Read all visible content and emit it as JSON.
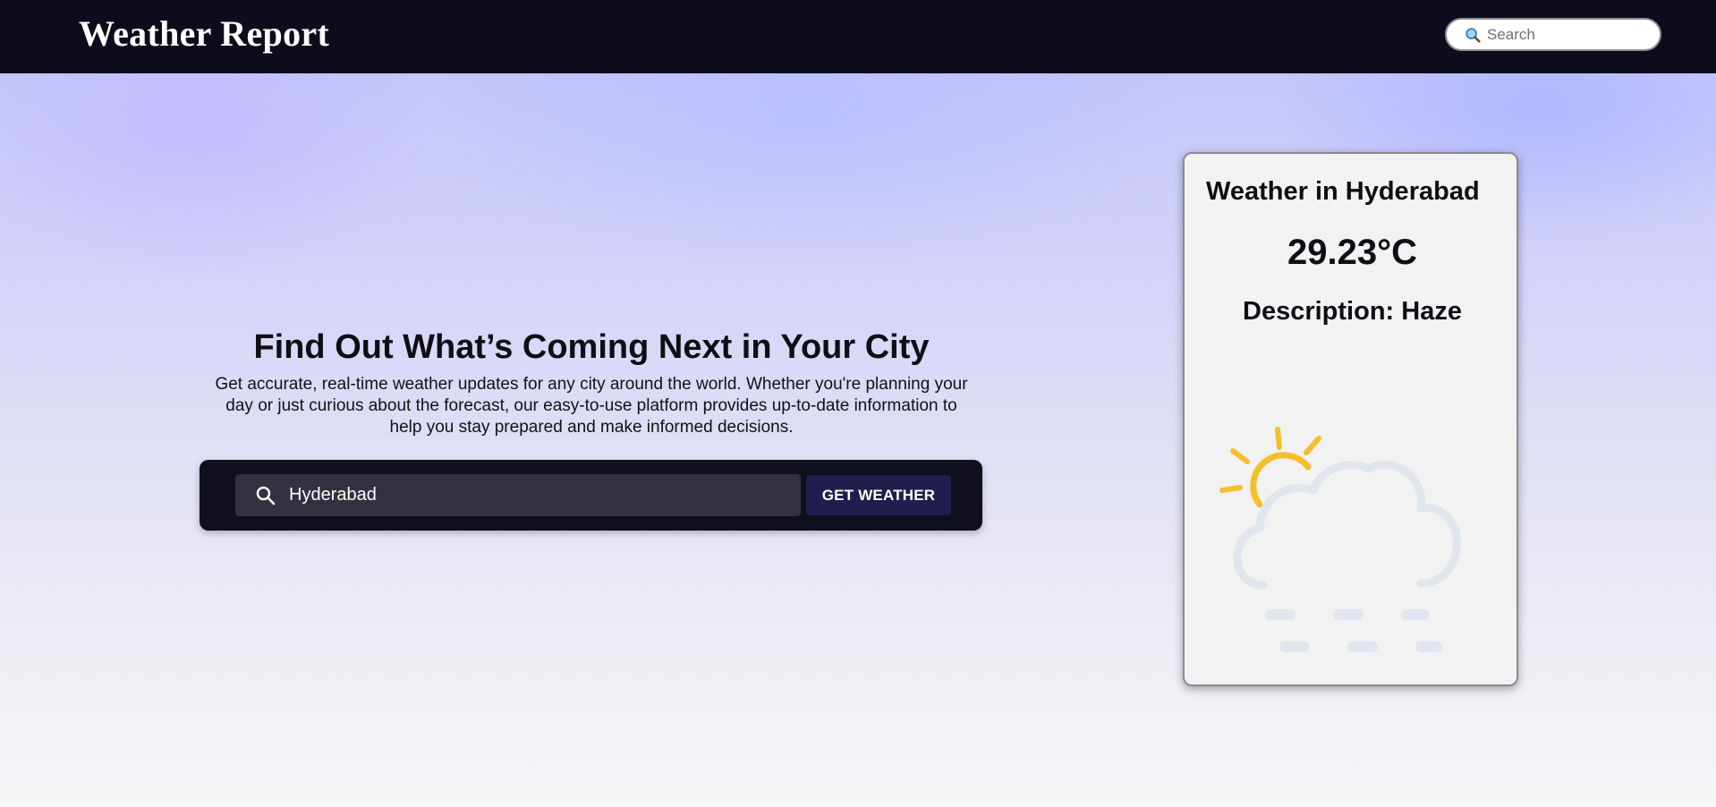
{
  "navbar": {
    "brand": "Weather Report",
    "search": {
      "icon": "magnifier-icon",
      "placeholder": "Search"
    }
  },
  "hero": {
    "headline": "Find Out What’s Coming Next in Your City",
    "intro": "Get accurate, real-time weather updates for any city around the world. Whether you're planning your day or just curious about the forecast, our easy-to-use platform provides up-to-date information to help you stay prepared and make informed decisions.",
    "city_search": {
      "icon": "search-icon",
      "value": "Hyderabad"
    },
    "button_label": "GET WEATHER"
  },
  "weather_card": {
    "title": "Weather in Hyderabad",
    "temperature": "29.23°C",
    "description_label": "Description:",
    "description_value": "Haze",
    "illustration": "haze-sun-cloud-icon"
  },
  "colors": {
    "navbar_bg": "#0c0c1c",
    "panel_bg": "#0f0f1e",
    "button_bg": "#1f1e4c",
    "sun": "#f5be2b",
    "cloud": "#e1e5ee"
  }
}
